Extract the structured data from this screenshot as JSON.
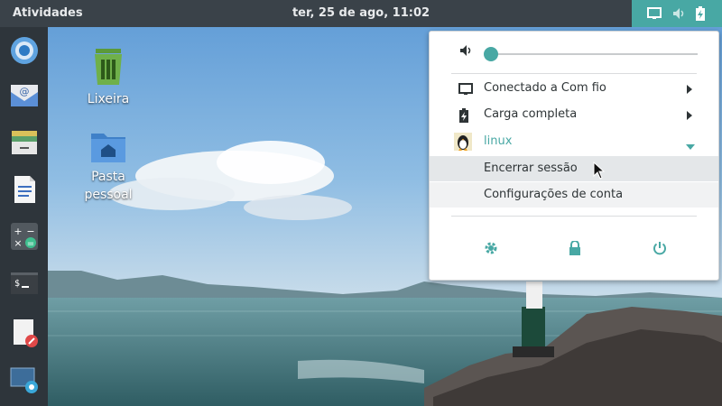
{
  "topbar": {
    "activities": "Atividades",
    "clock": "ter, 25 de ago, 11:02",
    "tray_icons": [
      "display-icon",
      "volume-icon",
      "battery-icon"
    ],
    "tray_color": "#48a8a4"
  },
  "dock": {
    "items": [
      "chromium-icon",
      "mail-icon",
      "files-icon",
      "document-icon",
      "calculator-icon",
      "terminal-icon",
      "notes-icon",
      "screenshot-icon"
    ]
  },
  "desktop": {
    "icons": [
      {
        "label": "Lixeira",
        "icon": "trash-icon"
      },
      {
        "label": "Pasta pessoal",
        "icon": "home-folder-icon"
      }
    ]
  },
  "menu": {
    "volume_level": 0.0,
    "network_label": "Conectado a Com fio",
    "battery_label": "Carga completa",
    "user_label": "linux",
    "accent": "#48a8a4",
    "submenu": [
      "Encerrar sessão",
      "Configurações de conta"
    ],
    "bottom_buttons": [
      "settings-icon",
      "lock-icon",
      "power-icon"
    ]
  }
}
